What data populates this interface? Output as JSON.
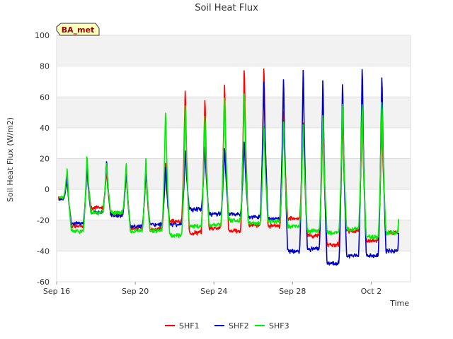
{
  "chart_data": {
    "type": "line",
    "title": "Soil Heat Flux",
    "xlabel": "Time",
    "ylabel": "Soil Heat Flux (W/m2)",
    "annotation": "BA_met",
    "ylim": [
      -60,
      100
    ],
    "yticks": [
      -60,
      -40,
      -20,
      0,
      20,
      40,
      60,
      80,
      100
    ],
    "xlim_days": [
      0,
      18
    ],
    "xaxis_type": "date",
    "xticks": [
      {
        "date": "2016-09-16",
        "label": "Sep 16"
      },
      {
        "date": "2016-09-20",
        "label": "Sep 20"
      },
      {
        "date": "2016-09-24",
        "label": "Sep 24"
      },
      {
        "date": "2016-09-28",
        "label": "Sep 28"
      },
      {
        "date": "2016-10-02",
        "label": "Oct 2"
      }
    ],
    "grid": true,
    "legend_position": "bottom-center",
    "x": [
      "2016-09-16",
      "2016-09-17",
      "2016-09-18",
      "2016-09-19",
      "2016-09-20",
      "2016-09-21",
      "2016-09-22",
      "2016-09-23",
      "2016-09-24",
      "2016-09-25",
      "2016-09-26",
      "2016-09-27",
      "2016-09-28",
      "2016-09-29",
      "2016-09-30",
      "2016-10-01",
      "2016-10-02",
      "2016-10-03"
    ],
    "series": [
      {
        "name": "SHF1",
        "color": "#ff0000",
        "daily_peak": [
          10,
          20,
          15,
          14,
          17,
          22,
          72,
          67,
          77,
          88,
          88,
          58,
          50,
          51,
          55,
          58,
          53,
          58
        ],
        "daily_min": [
          -6,
          -24,
          -12,
          -16,
          -25,
          -26,
          -21,
          -28,
          -25,
          -27,
          -23,
          -24,
          -19,
          -30,
          -36,
          -27,
          -33,
          -28
        ]
      },
      {
        "name": "SHF2",
        "color": "#0000cc",
        "daily_peak": [
          8,
          17,
          22,
          16,
          16,
          18,
          30,
          32,
          31,
          36,
          78,
          81,
          90,
          82,
          79,
          90,
          84,
          80
        ],
        "daily_min": [
          -6,
          -22,
          -15,
          -17,
          -24,
          -23,
          -23,
          -13,
          -16,
          -16,
          -18,
          -19,
          -40,
          -39,
          -48,
          -43,
          -43,
          -40
        ]
      },
      {
        "name": "SHF3",
        "color": "#00ee00",
        "daily_peak": [
          15,
          26,
          20,
          20,
          24,
          58,
          62,
          55,
          68,
          71,
          48,
          50,
          48,
          55,
          63,
          64,
          65,
          60
        ],
        "daily_min": [
          -5,
          -27,
          -15,
          -15,
          -27,
          -27,
          -30,
          -24,
          -23,
          -20,
          -22,
          -21,
          -24,
          -27,
          -28,
          -26,
          -31,
          -28
        ]
      }
    ]
  }
}
